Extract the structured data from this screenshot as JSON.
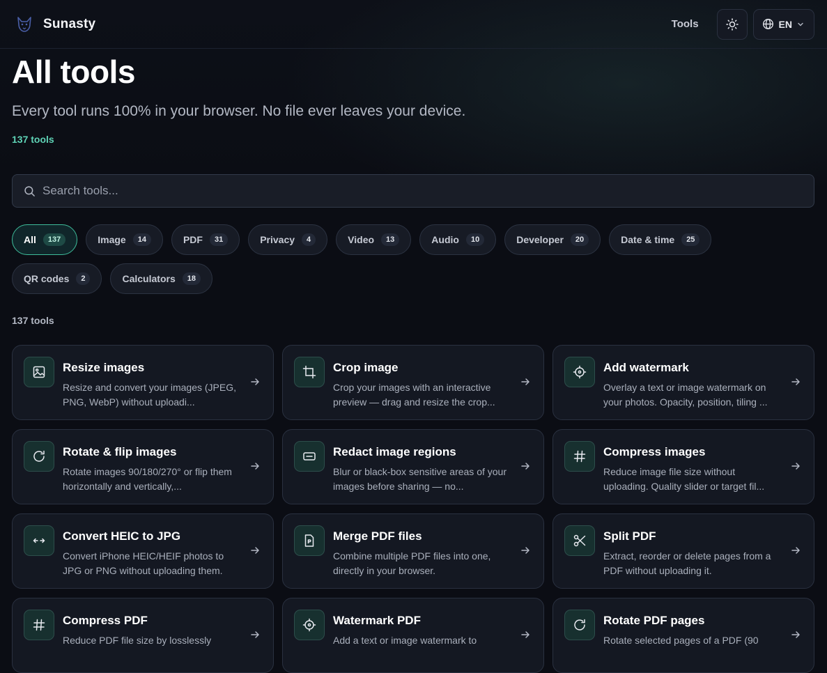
{
  "header": {
    "brand_name": "Sunasty",
    "nav_tools": "Tools",
    "language": "EN"
  },
  "page": {
    "title": "All tools",
    "subtitle": "Every tool runs 100% in your browser. No file ever leaves your device.",
    "tool_count": "137 tools"
  },
  "search": {
    "placeholder": "Search tools..."
  },
  "categories": [
    {
      "label": "All",
      "count": "137",
      "active": true
    },
    {
      "label": "Image",
      "count": "14"
    },
    {
      "label": "PDF",
      "count": "31"
    },
    {
      "label": "Privacy",
      "count": "4"
    },
    {
      "label": "Video",
      "count": "13"
    },
    {
      "label": "Audio",
      "count": "10"
    },
    {
      "label": "Developer",
      "count": "20"
    },
    {
      "label": "Date & time",
      "count": "25"
    },
    {
      "label": "QR codes",
      "count": "2"
    },
    {
      "label": "Calculators",
      "count": "18"
    }
  ],
  "results_label": "137 tools",
  "tools": [
    {
      "title": "Resize images",
      "desc": "Resize and convert your images (JPEG, PNG, WebP) without uploadi...",
      "icon": "image-icon"
    },
    {
      "title": "Crop image",
      "desc": "Crop your images with an interactive preview — drag and resize the crop...",
      "icon": "crop-icon"
    },
    {
      "title": "Add watermark",
      "desc": "Overlay a text or image watermark on your photos. Opacity, position, tiling ...",
      "icon": "crosshair-icon"
    },
    {
      "title": "Rotate & flip images",
      "desc": "Rotate images 90/180/270° or flip them horizontally and vertically,...",
      "icon": "rotate-icon"
    },
    {
      "title": "Redact image regions",
      "desc": "Blur or black-box sensitive areas of your images before sharing — no...",
      "icon": "redact-icon"
    },
    {
      "title": "Compress images",
      "desc": "Reduce image file size without uploading. Quality slider or target fil...",
      "icon": "hash-icon"
    },
    {
      "title": "Convert HEIC to JPG",
      "desc": "Convert iPhone HEIC/HEIF photos to JPG or PNG without uploading them.",
      "icon": "convert-arrows-icon"
    },
    {
      "title": "Merge PDF files",
      "desc": "Combine multiple PDF files into one, directly in your browser.",
      "icon": "pdf-file-icon"
    },
    {
      "title": "Split PDF",
      "desc": "Extract, reorder or delete pages from a PDF without uploading it.",
      "icon": "scissors-icon"
    },
    {
      "title": "Compress PDF",
      "desc": "Reduce PDF file size by losslessly",
      "icon": "hash-icon"
    },
    {
      "title": "Watermark PDF",
      "desc": "Add a text or image watermark to",
      "icon": "crosshair-icon"
    },
    {
      "title": "Rotate PDF pages",
      "desc": "Rotate selected pages of a PDF (90",
      "icon": "rotate-icon"
    }
  ],
  "colors": {
    "accent": "#5fd3b6",
    "background": "#0b0d14",
    "card": "#141822"
  }
}
